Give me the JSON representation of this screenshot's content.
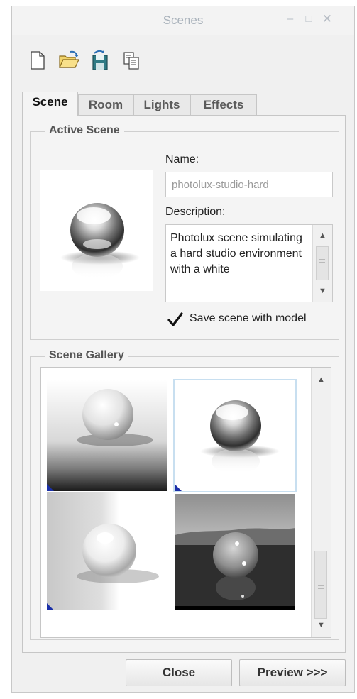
{
  "window": {
    "title": "Scenes",
    "controls": {
      "minimize_icon": "minimize-icon",
      "maximize_icon": "maximize-icon",
      "close_icon": "close-icon"
    }
  },
  "toolbar": {
    "tools": [
      "new-scene-icon",
      "open-folder-icon",
      "save-icon",
      "copy-icon"
    ]
  },
  "tabs": [
    {
      "label": "Scene",
      "active": true
    },
    {
      "label": "Room",
      "active": false
    },
    {
      "label": "Lights",
      "active": false
    },
    {
      "label": "Effects",
      "active": false
    }
  ],
  "active_scene": {
    "legend": "Active Scene",
    "name_label": "Name:",
    "name_value": "photolux-studio-hard",
    "description_label": "Description:",
    "description_value": "Photolux scene simulating a hard studio environment with a white",
    "save_with_model_label": "Save scene with model",
    "save_with_model_checked": true
  },
  "gallery": {
    "legend": "Scene Gallery",
    "selected_index": 1
  },
  "buttons": {
    "close_label": "Close",
    "preview_label": "Preview >>>"
  }
}
